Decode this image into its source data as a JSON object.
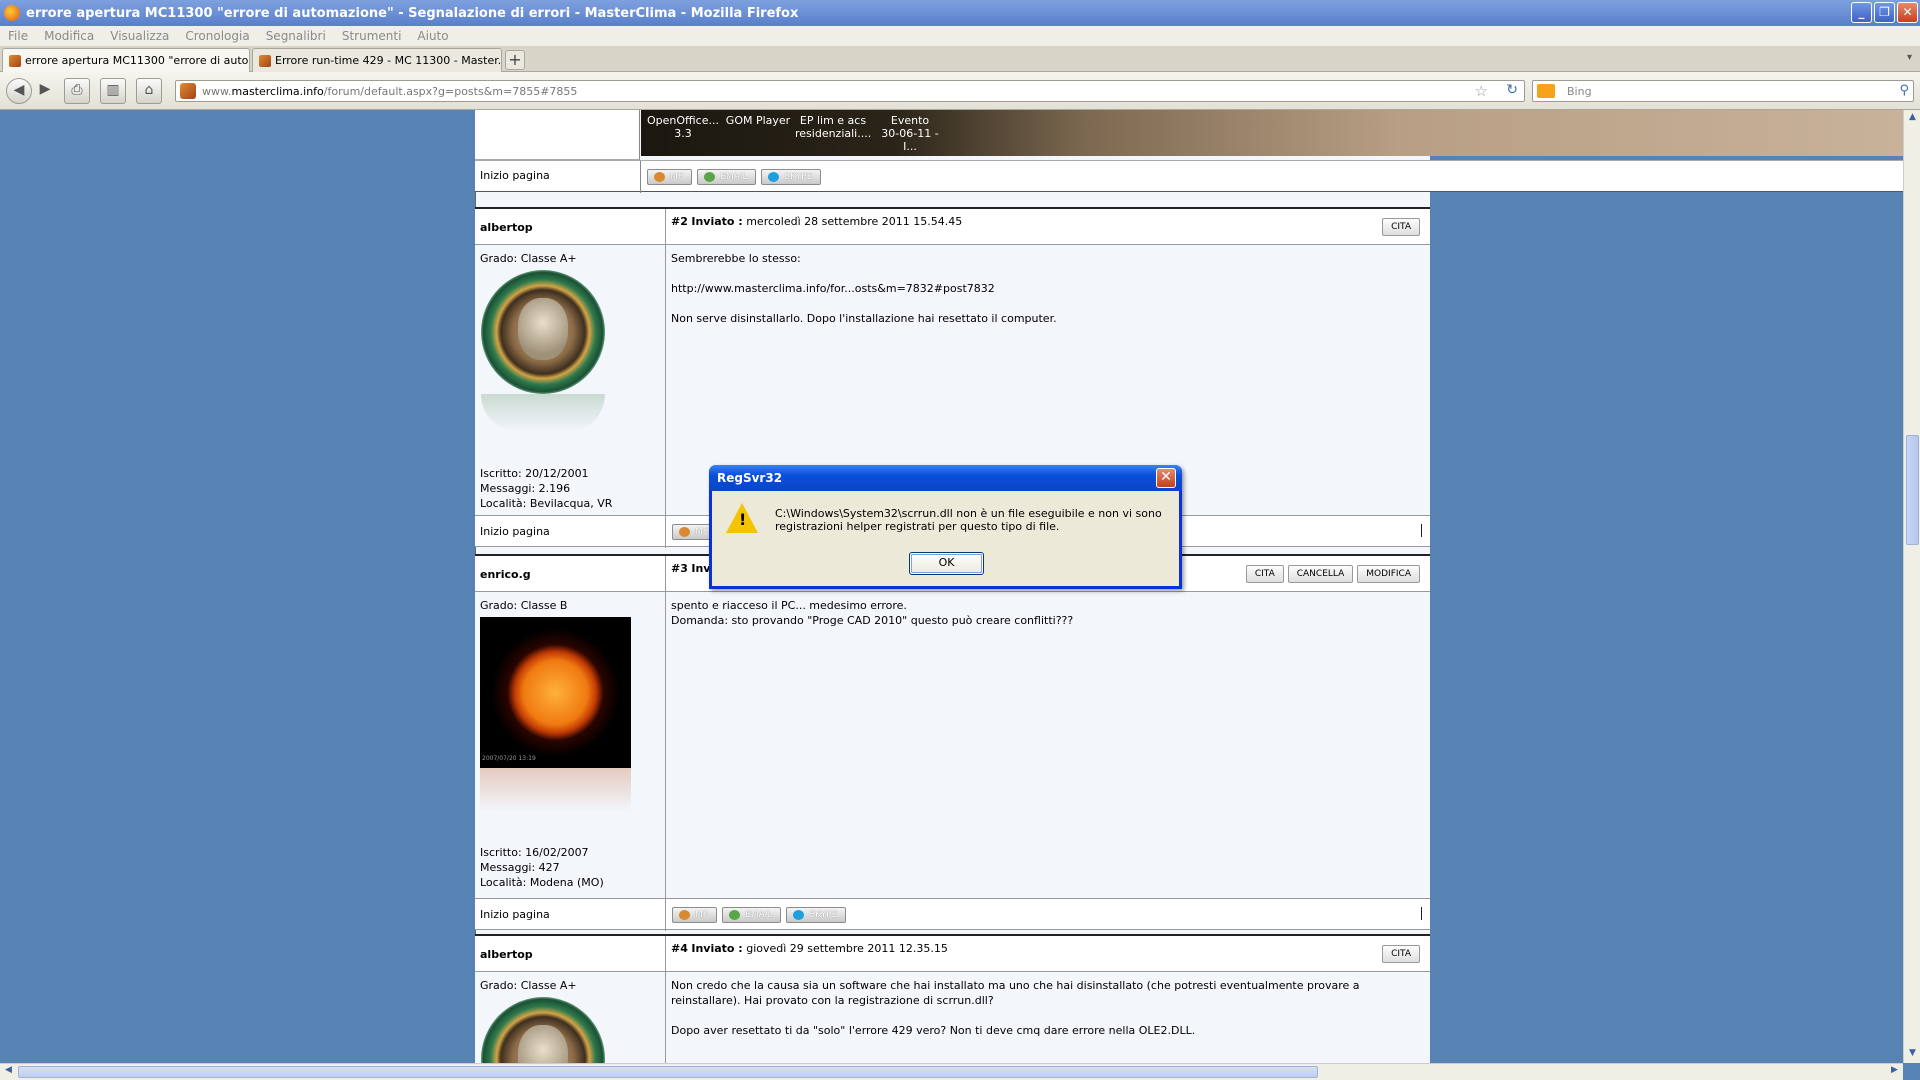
{
  "window": {
    "title": "errore apertura MC11300 \"errore di automazione\" - Segnalazione di errori - MasterClima - Mozilla Firefox",
    "minimize": "_",
    "restore": "❐",
    "close": "✕"
  },
  "menu": [
    "File",
    "Modifica",
    "Visualizza",
    "Cronologia",
    "Segnalibri",
    "Strumenti",
    "Aiuto"
  ],
  "tabs": [
    {
      "label": "errore apertura MC11300 \"errore di auto...",
      "close": "✕"
    },
    {
      "label": "Errore run-time 429 - MC 11300 - Master...",
      "close": "✕"
    }
  ],
  "newtab": "+",
  "tabmenu": "▾",
  "nav": {
    "url_domain_prefix": "www.",
    "url_domain": "masterclima.info",
    "url_path": "/forum/default.aspx?g=posts&m=7855#7855",
    "search_placeholder": "Bing",
    "back": "◀",
    "forward": "▶",
    "print": "⎙",
    "stats": "▥",
    "home": "⌂",
    "star": "☆",
    "reload": "↻",
    "search": "⚲"
  },
  "banner": {
    "tiles": [
      {
        "line1": "OpenOffice...",
        "line2": "3.3"
      },
      {
        "line1": "GOM Player",
        "line2": ""
      },
      {
        "line1": "EP lim e acs",
        "line2": "residenziali...."
      },
      {
        "line1": "Evento",
        "line2": "30-06-11 - I..."
      }
    ],
    "footer_label": "Inizio pagina"
  },
  "buttons": {
    "mp": "MP",
    "email": "EMAIL",
    "skype": "SKYPE",
    "cita": "CITA",
    "cancella": "CANCELLA",
    "modifica": "MODIFICA"
  },
  "posts": [
    {
      "author": "albertop",
      "number": "#2",
      "sent_label": "Inviato :",
      "date": "mercoledì 28 settembre 2011 15.54.45",
      "grade": "Grado: Classe A+",
      "joined": "Iscritto: 20/12/2001",
      "messages": "Messaggi: 2.196",
      "location": "Località: Bevilacqua, VR",
      "paragraphs": [
        "Sembrerebbe lo stesso:",
        "http://www.masterclima.info/for...osts&m=7832#post7832",
        "Non serve disinstallarlo. Dopo l'installazione hai resettato il computer."
      ],
      "footer_label": "Inizio pagina"
    },
    {
      "author": "enrico.g",
      "number": "#3",
      "sent_label": "Inviato",
      "date": "",
      "grade": "Grado: Classe B",
      "avatar_date": "2007/07/20 13:19",
      "joined": "Iscritto: 16/02/2007",
      "messages": "Messaggi: 427",
      "location": "Località: Modena (MO)",
      "paragraphs": [
        "spento e riacceso il PC... medesimo errore.",
        "Domanda: sto provando \"Proge CAD 2010\" questo può creare conflitti???"
      ],
      "footer_label": "Inizio pagina"
    },
    {
      "author": "albertop",
      "number": "#4",
      "sent_label": "Inviato :",
      "date": "giovedì 29 settembre 2011 12.35.15",
      "grade": "Grado: Classe A+",
      "paragraphs": [
        "Non credo che la causa sia un software che hai installato ma uno che hai disinstallato (che potresti eventualmente provare a reinstallare). Hai provato con la registrazione di scrrun.dll?",
        "Dopo aver resettato ti da \"solo\" l'errore 429 vero? Non ti deve cmq dare errore nella OLE2.DLL."
      ]
    }
  ],
  "dialog": {
    "title": "RegSvr32",
    "message": "C:\\Windows\\System32\\scrrun.dll non è un file eseguibile e non vi sono registrazioni helper registrati per questo tipo di file.",
    "ok": "OK",
    "close": "✕",
    "warn_mark": "!"
  },
  "scroll": {
    "up": "▲",
    "down": "▼",
    "left": "◀",
    "right": "▶"
  },
  "colors": {
    "page_background": "#5683b4",
    "dialog_border": "#0831d9",
    "warning": "#f5c400"
  }
}
